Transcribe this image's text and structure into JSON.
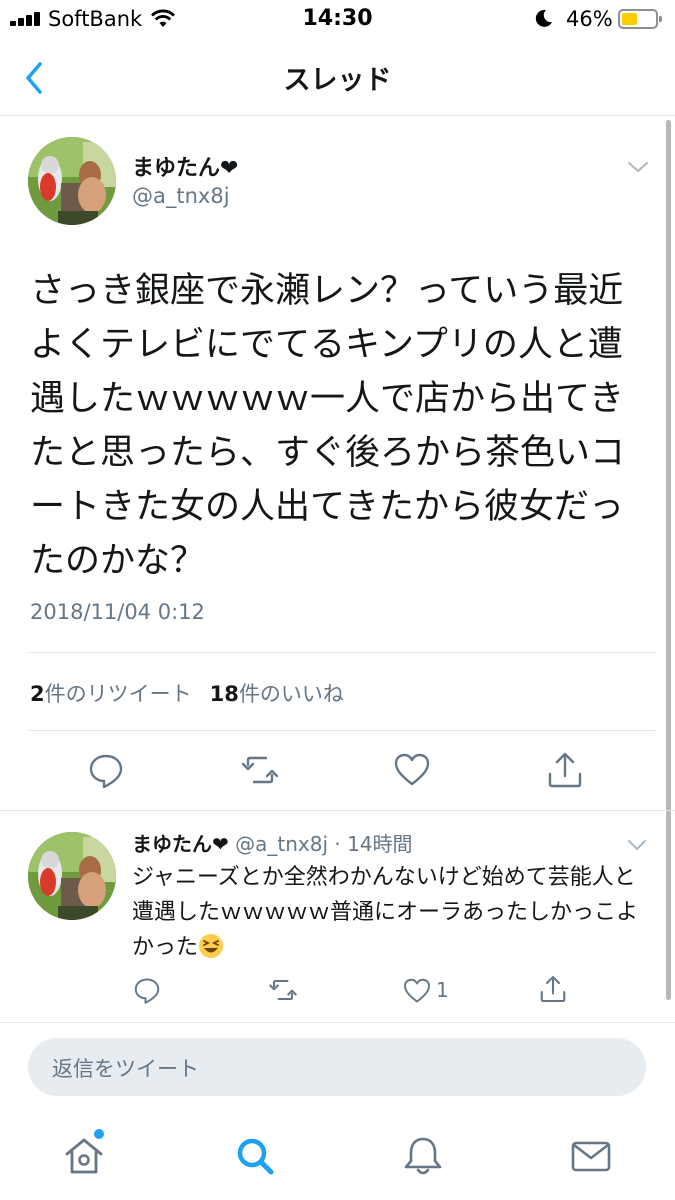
{
  "status_bar": {
    "carrier": "SoftBank",
    "time": "14:30",
    "battery_percent": "46%",
    "battery_level": 0.46,
    "battery_color": "#ffcc00"
  },
  "nav": {
    "title": "スレッド"
  },
  "main_tweet": {
    "name": "まゆたん❤",
    "handle": "@a_tnx8j",
    "text": "さっき銀座で永瀬レン？っていう最近よくテレビにでてるキンプリの人と遭遇したｗｗｗｗｗ一人で店から出てきたと思ったら、すぐ後ろから茶色いコートきた女の人出てきたから彼女だったのかな？",
    "timestamp": "2018/11/04 0:12",
    "retweet_count": "2",
    "retweet_label": "件のリツイート",
    "like_count": "18",
    "like_label": "件のいいね"
  },
  "reply_tweet": {
    "name": "まゆたん❤",
    "handle_time": "@a_tnx8j · 14時間",
    "text": "ジャニーズとか全然わかんないけど始めて芸能人と遭遇したｗｗｗｗｗ普通にオーラあったしかっこよかった",
    "like_count": "1"
  },
  "reply_box": {
    "placeholder": "返信をツイート"
  },
  "icons": {
    "accent": "#1da1f2",
    "action_gray": "#657786"
  }
}
